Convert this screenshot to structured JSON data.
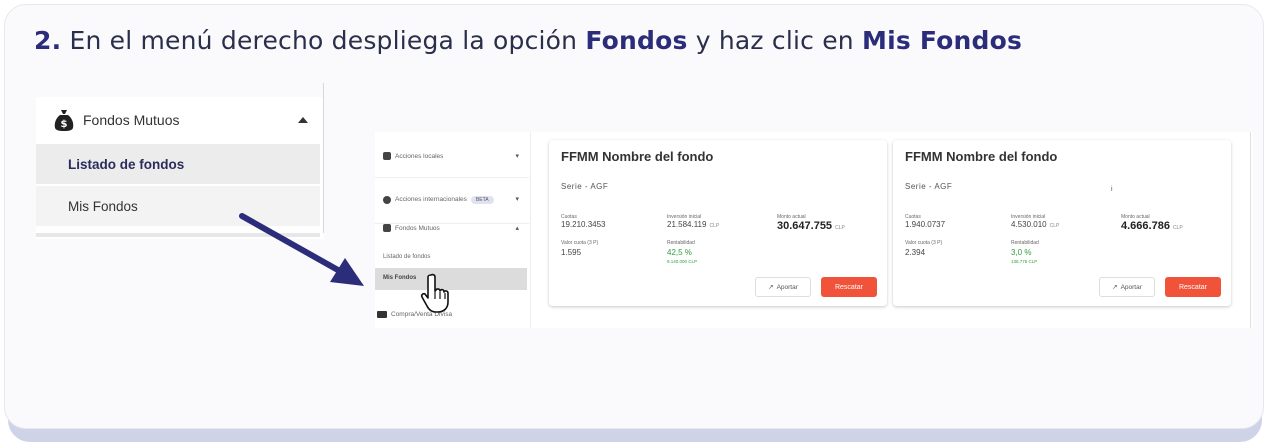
{
  "instruction": {
    "step": "2.",
    "text_before": " En el menú derecho despliega la opción ",
    "bold1": "Fondos",
    "text_middle": " y haz clic en ",
    "bold2": "Mis Fondos"
  },
  "zoom_menu": {
    "header": "Fondos Mutuos",
    "items": [
      "Listado de fondos",
      "Mis Fondos"
    ]
  },
  "small_sidebar": {
    "row1": "Acciones locales",
    "row2": "Acciones internacionales",
    "row2_badge": "BETA",
    "row3": "Fondos Mutuos",
    "sub1": "Listado de fondos",
    "sub2": "Mis Fondos",
    "row4": "Compra/Venta Divisa"
  },
  "funds": [
    {
      "title": "FFMM Nombre del fondo",
      "serie": "Serie - AGF",
      "k_cuotas": "Cuotas",
      "v_cuotas": "19.210.3453",
      "k_inv": "Inversión inicial",
      "v_inv": "21.584.119",
      "k_monto": "Monto actual",
      "v_monto": "30.647.755",
      "k_valor": "Valor cuota (3 P)",
      "v_valor": "1.595",
      "k_rent": "Rentabilidad",
      "v_rent": "42,5 %",
      "v_rent_small": "9.140.000 CLP",
      "unit": "CLP",
      "aportar": "Aportar",
      "rescatar": "Rescatar"
    },
    {
      "title": "FFMM Nombre del fondo",
      "serie": "Serie - AGF",
      "dot": "i",
      "k_cuotas": "Cuotas",
      "v_cuotas": "1.940.0737",
      "k_inv": "Inversión inicial",
      "v_inv": "4.530.010",
      "k_monto": "Monto actual",
      "v_monto": "4.666.786",
      "k_valor": "Valor cuota (3 P)",
      "v_valor": "2.394",
      "k_rent": "Rentabilidad",
      "v_rent": "3,0 %",
      "v_rent_small": "136.776 CLP",
      "unit": "CLP",
      "aportar": "Aportar",
      "rescatar": "Rescatar"
    }
  ],
  "colors": {
    "accent": "#2b2c7a",
    "rescatar": "#f0533a",
    "positive": "#2e9e3e",
    "card_bg": "#fafafd",
    "card_shadow": "#cfd3e8"
  }
}
